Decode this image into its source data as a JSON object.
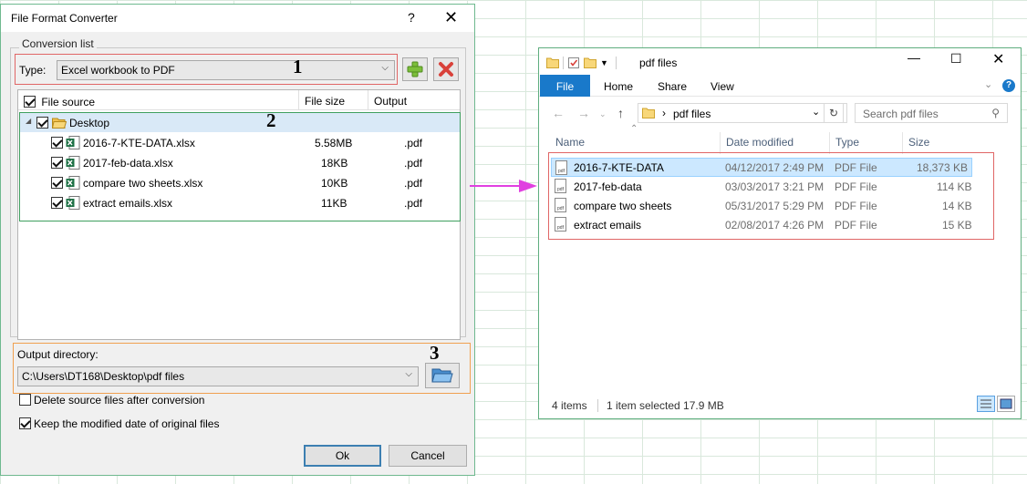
{
  "dialog": {
    "title": "File Format Converter",
    "help": "?",
    "close": "✕",
    "group_label": "Conversion list",
    "type_label": "Type:",
    "type_value": "Excel workbook to PDF",
    "step1": "1",
    "step2": "2",
    "step3": "3",
    "columns": [
      "File source",
      "File size",
      "Output"
    ],
    "folder": "Desktop",
    "files": [
      {
        "name": "2016-7-KTE-DATA.xlsx",
        "size": "5.58MB",
        "output": ".pdf"
      },
      {
        "name": "2017-feb-data.xlsx",
        "size": "18KB",
        "output": ".pdf"
      },
      {
        "name": "compare two sheets.xlsx",
        "size": "10KB",
        "output": ".pdf"
      },
      {
        "name": "extract emails.xlsx",
        "size": "11KB",
        "output": ".pdf"
      }
    ],
    "output_label": "Output directory:",
    "output_path": "C:\\Users\\DT168\\Desktop\\pdf files",
    "opt_delete": "Delete source files after conversion",
    "opt_keep": "Keep the modified date of original files",
    "ok": "Ok",
    "cancel": "Cancel"
  },
  "explorer": {
    "title": "pdf files",
    "tabs": [
      "File",
      "Home",
      "Share",
      "View"
    ],
    "address": "pdf files",
    "address_sep": "›",
    "search_placeholder": "Search pdf files",
    "columns": [
      "Name",
      "Date modified",
      "Type",
      "Size"
    ],
    "files": [
      {
        "name": "2016-7-KTE-DATA",
        "date": "04/12/2017 2:49 PM",
        "type": "PDF File",
        "size": "18,373 KB"
      },
      {
        "name": "2017-feb-data",
        "date": "03/03/2017 3:21 PM",
        "type": "PDF File",
        "size": "114 KB"
      },
      {
        "name": "compare two sheets",
        "date": "05/31/2017 5:29 PM",
        "type": "PDF File",
        "size": "14 KB"
      },
      {
        "name": "extract emails",
        "date": "02/08/2017 4:26 PM",
        "type": "PDF File",
        "size": "15 KB"
      }
    ],
    "status_items": "4 items",
    "status_selected": "1 item selected  17.9 MB"
  },
  "colors": {
    "accent": "#1979ca",
    "annotation_red": "#e06666",
    "annotation_orange": "#f0a050",
    "annotation_green": "#3f9f5f",
    "arrow": "#e040e0"
  }
}
